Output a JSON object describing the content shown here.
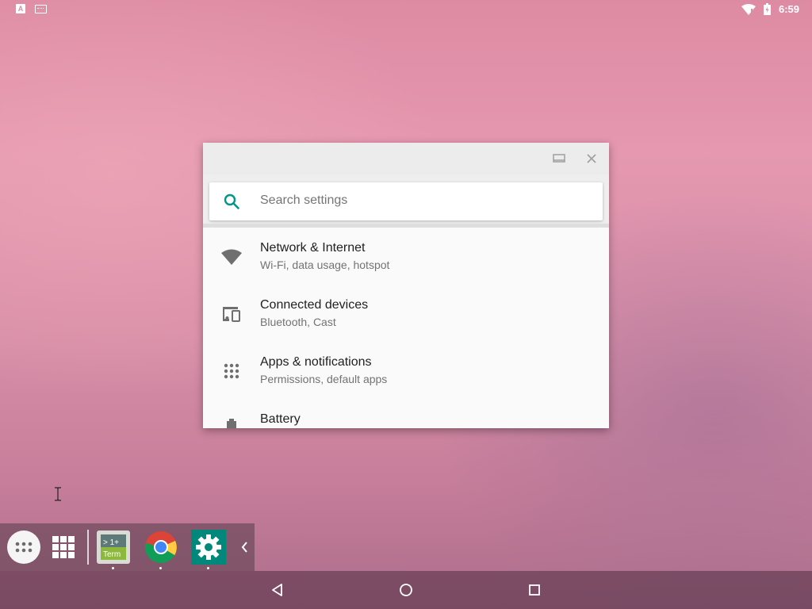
{
  "status_bar": {
    "time": "6:59",
    "icons": [
      "notification-a-icon",
      "keyboard-notification-icon",
      "wifi-icon",
      "battery-icon"
    ]
  },
  "settings_window": {
    "search": {
      "placeholder": "Search settings"
    },
    "items": [
      {
        "title": "Network & Internet",
        "subtitle": "Wi-Fi, data usage, hotspot",
        "icon": "wifi-icon"
      },
      {
        "title": "Connected devices",
        "subtitle": "Bluetooth, Cast",
        "icon": "devices-icon"
      },
      {
        "title": "Apps & notifications",
        "subtitle": "Permissions, default apps",
        "icon": "apps-grid-icon"
      },
      {
        "title": "Battery",
        "subtitle": "",
        "icon": "battery-icon"
      }
    ]
  },
  "taskbar": {
    "items": [
      "app-drawer",
      "window-grid",
      "terminal-emulator",
      "chrome",
      "settings"
    ],
    "terminal_label_top": "> 1+",
    "terminal_label_bottom": "Term"
  },
  "navbar": {
    "buttons": [
      "back",
      "home",
      "recents"
    ]
  },
  "colors": {
    "accent": "#009688",
    "window_bg": "#fafafa"
  }
}
